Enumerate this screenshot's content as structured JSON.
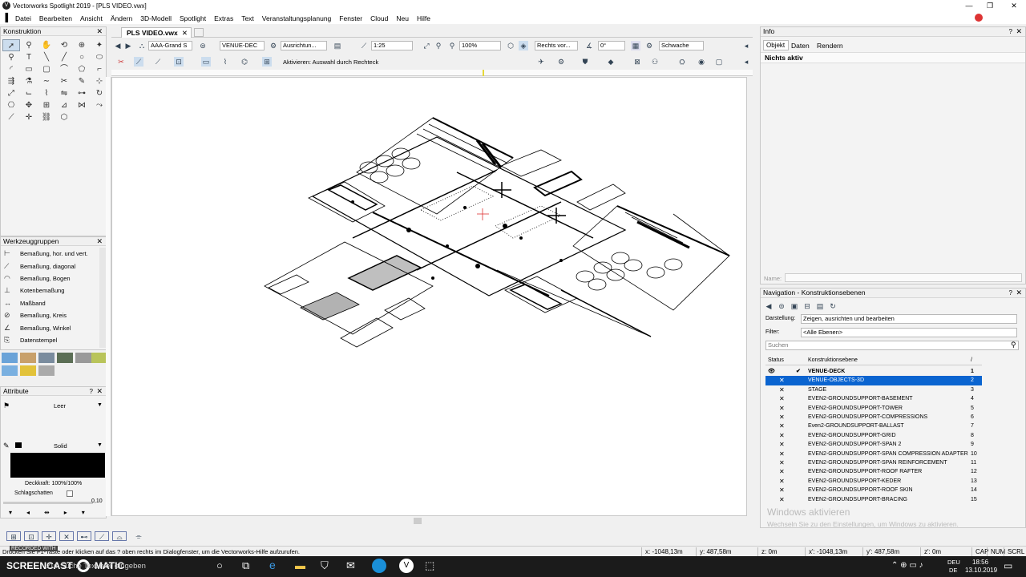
{
  "window": {
    "title": "Vectorworks Spotlight 2019 - [PLS VIDEO.vwx]",
    "min": "—",
    "max": "❐",
    "close": "✕"
  },
  "menu": [
    "Datei",
    "Bearbeiten",
    "Ansicht",
    "Ändern",
    "3D-Modell",
    "Spotlight",
    "Extras",
    "Text",
    "Veranstaltungsplanung",
    "Fenster",
    "Cloud",
    "Neu",
    "Hilfe"
  ],
  "konstruktion": {
    "title": "Konstruktion"
  },
  "werkzeuggruppen": {
    "title": "Werkzeuggruppen",
    "items": [
      "Bemaßung, hor. und vert.",
      "Bemaßung, diagonal",
      "Bemaßung, Bogen",
      "Kotenbemaßung",
      "Maßband",
      "Bemaßung, Kreis",
      "Bemaßung, Winkel",
      "Datenstempel"
    ]
  },
  "attribute": {
    "title": "Attribute",
    "fill": "Leer",
    "pen": "Solid",
    "opacity": "Deckkraft: 100%/100%",
    "shadow": "Schlagschatten",
    "thickness": "0,10"
  },
  "doc_tab": "PLS VIDEO.vwx",
  "toolbar1": {
    "scale_class": "AAA-Grand S",
    "layer": "VENUE-DEC",
    "align": "Ausrichtun...",
    "scale": "1:25",
    "zoom": "100%",
    "view": "Rechts vor...",
    "angle": "0°",
    "render": "Schwache"
  },
  "toolbar2": {
    "mode_text": "Aktivieren: Auswahl durch Rechteck"
  },
  "info": {
    "title": "Info",
    "tabs": [
      "Objekt",
      "Daten",
      "Rendern"
    ],
    "status": "Nichts aktiv",
    "name_label": "Name:"
  },
  "navigation": {
    "title": "Navigation - Konstruktionsebenen",
    "darstellung_label": "Darstellung:",
    "darstellung_value": "Zeigen, ausrichten und bearbeiten",
    "filter_label": "Filter:",
    "filter_value": "<Alle Ebenen>",
    "search_placeholder": "Suchen",
    "col_status": "Status",
    "col_name": "Konstruktionsebene",
    "col_nr": "/",
    "layers": [
      {
        "name": "VENUE-DECK",
        "nr": "1"
      },
      {
        "name": "VENUE-OBJECTS-3D",
        "nr": "2"
      },
      {
        "name": "STAGE",
        "nr": "3"
      },
      {
        "name": "EVEN2-GROUNDSUPPORT-BASEMENT",
        "nr": "4"
      },
      {
        "name": "EVEN2-GROUNDSUPPORT-TOWER",
        "nr": "5"
      },
      {
        "name": "EVEN2-GROUNDSUPPORT-COMPRESSIONS",
        "nr": "6"
      },
      {
        "name": "Even2-GROUNDSUPPORT-BALLAST",
        "nr": "7"
      },
      {
        "name": "EVEN2-GROUNDSUPPORT-GRID",
        "nr": "8"
      },
      {
        "name": "EVEN2-GROUNDSUPPORT-SPAN 2",
        "nr": "9"
      },
      {
        "name": "EVEN2-GROUNDSUPPORT-SPAN COMPRESSION ADAPTER",
        "nr": "10"
      },
      {
        "name": "EVEN2-GROUNDSUPPORT-SPAN REINFORCEMENT",
        "nr": "11"
      },
      {
        "name": "EVEN2-GROUNDSUPPORT-ROOF RAFTER",
        "nr": "12"
      },
      {
        "name": "EVEN2-GROUNDSUPPORT-KEDER",
        "nr": "13"
      },
      {
        "name": "EVEN2-GROUNDSUPPORT-ROOF SKIN",
        "nr": "14"
      },
      {
        "name": "EVEN2-GROUNDSUPPORT-BRACING",
        "nr": "15"
      }
    ]
  },
  "watermark": {
    "line1": "Windows aktivieren",
    "line2": "Wechseln Sie zu den Einstellungen, um Windows zu aktivieren."
  },
  "status": {
    "help": "Drücken Sie F1-Taste oder klicken auf das ? oben rechts im Dialogfenster, um die Vectorworks-Hilfe aufzurufen.",
    "x": "x: -1048,13m",
    "y": "y: 487,58m",
    "z": "z: 0m",
    "x2": "x': -1048,13m",
    "y2": "y': 487,58m",
    "z2": "z': 0m",
    "keys": [
      "CAP",
      "NUM",
      "SCRL"
    ]
  },
  "taskbar": {
    "search": "Zur Suche Text hier eingeben",
    "time": "18:56",
    "date": "13.10.2019",
    "lang1": "DEU",
    "lang2": "DE",
    "recorded": "RECORDED WITH",
    "brand": "SCREENCAST",
    "brand2": "MATIC"
  }
}
